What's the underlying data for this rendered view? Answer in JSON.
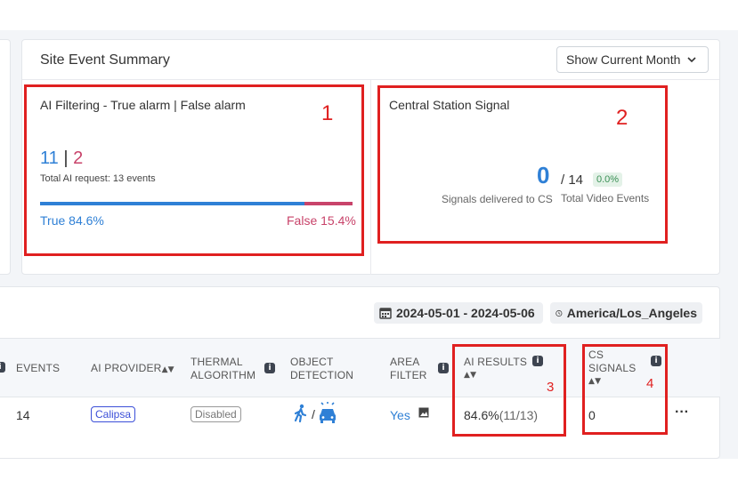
{
  "summary": {
    "title": "Site Event Summary",
    "month_button": "Show Current Month"
  },
  "ai_filtering": {
    "title": "AI Filtering - True alarm | False alarm",
    "true_count": "11",
    "separator": "|",
    "false_count": "2",
    "total_text": "Total AI request: 13 events",
    "true_pct_label": "True 84.6%",
    "false_pct_label": "False 15.4%",
    "true_fraction": 0.846,
    "colors": {
      "true": "#2f80d6",
      "false": "#c8436a"
    }
  },
  "central_station": {
    "title": "Central Station Signal",
    "delivered": "0",
    "total": "/ 14",
    "pct": "0.0%",
    "delivered_label": "Signals delivered to CS",
    "total_label": "Total Video Events"
  },
  "filters": {
    "date_range": "2024-05-01 - 2024-05-06",
    "timezone": "America/Los_Angeles",
    "icons": {
      "date": "calendar-icon",
      "timezone": "clock-icon"
    }
  },
  "table": {
    "headers": {
      "events": "EVENTS",
      "ai_provider": "AI PROVIDER",
      "thermal_1": "THERMAL",
      "thermal_2": "ALGORITHM",
      "object_1": "OBJECT",
      "object_2": "DETECTION",
      "area_1": "AREA",
      "area_2": "FILTER",
      "ai_results": "AI RESULTS",
      "cs_1": "CS",
      "cs_2": "SIGNALS"
    },
    "row": {
      "events": "14",
      "ai_provider": "Calipsa",
      "thermal": "Disabled",
      "object_sep": "/",
      "area": "Yes",
      "ai_results_pct": "84.6%",
      "ai_results_detail": "(11/13)",
      "cs_signals": "0",
      "more": "···"
    }
  },
  "annotations": {
    "box_1": "1",
    "box_2": "2",
    "box_3": "3",
    "box_4": "4",
    "color": "#e02020"
  }
}
